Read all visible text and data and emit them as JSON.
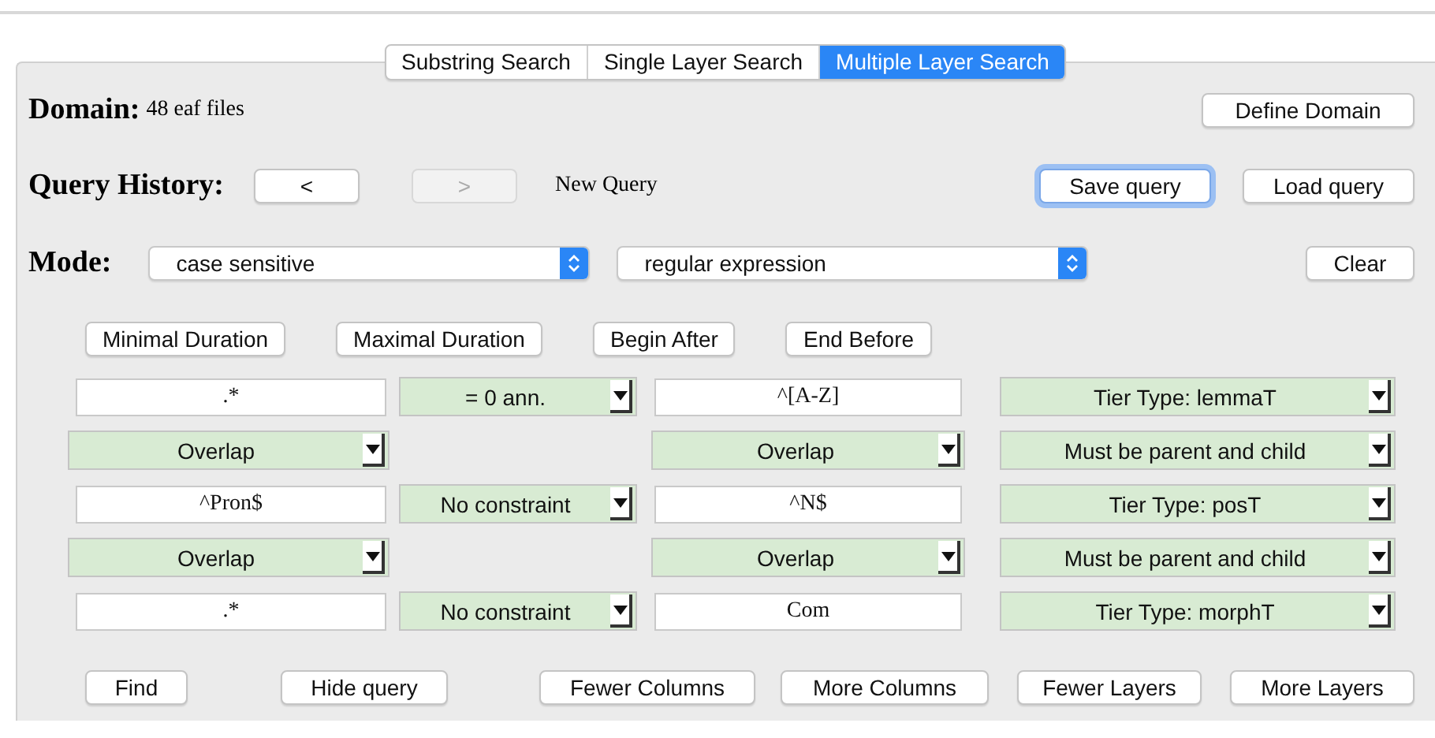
{
  "tabs": [
    {
      "label": "Substring Search",
      "selected": false
    },
    {
      "label": "Single Layer Search",
      "selected": false
    },
    {
      "label": "Multiple Layer Search",
      "selected": true
    }
  ],
  "domain": {
    "label": "Domain:",
    "value": "48 eaf files",
    "button": "Define Domain"
  },
  "query_history": {
    "label": "Query History:",
    "back_button": {
      "label": "<",
      "disabled": false
    },
    "forward_button": {
      "label": ">",
      "disabled": true
    },
    "current": "New Query",
    "save_button": {
      "label": "Save query",
      "focused": true
    },
    "load_button": {
      "label": "Load query",
      "focused": false
    }
  },
  "mode": {
    "label": "Mode:",
    "case_select": "case sensitive",
    "match_select": "regular expression",
    "clear_button": "Clear"
  },
  "constraint_buttons": [
    "Minimal Duration",
    "Maximal Duration",
    "Begin After",
    "End Before"
  ],
  "query_rows": [
    {
      "kind": "layer",
      "cells": [
        {
          "kind": "field",
          "value": ".*"
        },
        {
          "kind": "combo",
          "value": "= 0 ann."
        },
        {
          "kind": "field",
          "value": "^[A-Z]"
        },
        {
          "kind": "combo",
          "value": "Tier Type: lemmaT"
        }
      ]
    },
    {
      "kind": "relation",
      "cells": [
        {
          "kind": "combo",
          "value": "Overlap"
        },
        {
          "kind": "combo",
          "value": "Overlap"
        },
        {
          "kind": "combo",
          "value": "Must be parent and child"
        }
      ]
    },
    {
      "kind": "layer",
      "cells": [
        {
          "kind": "field",
          "value": "^Pron$"
        },
        {
          "kind": "combo",
          "value": "No constraint"
        },
        {
          "kind": "field",
          "value": "^N$"
        },
        {
          "kind": "combo",
          "value": "Tier Type: posT"
        }
      ]
    },
    {
      "kind": "relation",
      "cells": [
        {
          "kind": "combo",
          "value": "Overlap"
        },
        {
          "kind": "combo",
          "value": "Overlap"
        },
        {
          "kind": "combo",
          "value": "Must be parent and child"
        }
      ]
    },
    {
      "kind": "layer",
      "cells": [
        {
          "kind": "field",
          "value": ".*"
        },
        {
          "kind": "combo",
          "value": "No constraint"
        },
        {
          "kind": "field",
          "value": "Com"
        },
        {
          "kind": "combo",
          "value": "Tier Type: morphT"
        }
      ]
    }
  ],
  "bottom_buttons": [
    "Find",
    "Hide query",
    "Fewer Columns",
    "More Columns",
    "Fewer Layers",
    "More Layers"
  ]
}
